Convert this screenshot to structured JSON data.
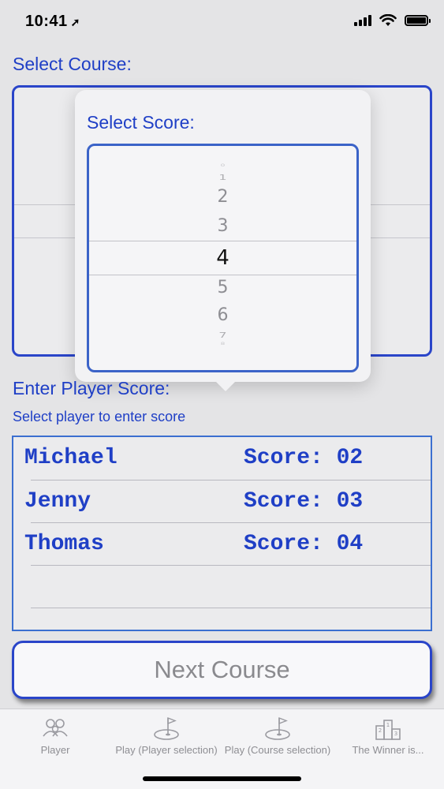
{
  "status_bar": {
    "time": "10:41",
    "location_icon": "location-arrow-icon"
  },
  "course_section": {
    "label": "Select Course:"
  },
  "score_popover": {
    "title": "Select Score:",
    "wheel": [
      {
        "value": "0"
      },
      {
        "value": "1"
      },
      {
        "value": "2"
      },
      {
        "value": "3"
      },
      {
        "value": "4",
        "selected": true
      },
      {
        "value": "5"
      },
      {
        "value": "6"
      },
      {
        "value": "7"
      },
      {
        "value": "8"
      }
    ]
  },
  "player_section": {
    "label": "Enter Player Score:",
    "hint": "Select player to enter score",
    "players": [
      {
        "name": "Michael",
        "score": "Score: 02"
      },
      {
        "name": "Jenny",
        "score": "Score: 03"
      },
      {
        "name": "Thomas",
        "score": "Score: 04"
      }
    ]
  },
  "next_button": {
    "label": "Next Course"
  },
  "tabbar": {
    "tabs": [
      {
        "label": "Player",
        "icon": "players-icon"
      },
      {
        "label": "Play (Player selection)",
        "icon": "golf-hole-icon"
      },
      {
        "label": "Play (Course selection)",
        "icon": "golf-hole-icon"
      },
      {
        "label": "The Winner is...",
        "icon": "podium-icon"
      }
    ]
  },
  "colors": {
    "accent": "#1f3fc6",
    "border": "#2a45c9",
    "muted": "#8e8e93"
  }
}
